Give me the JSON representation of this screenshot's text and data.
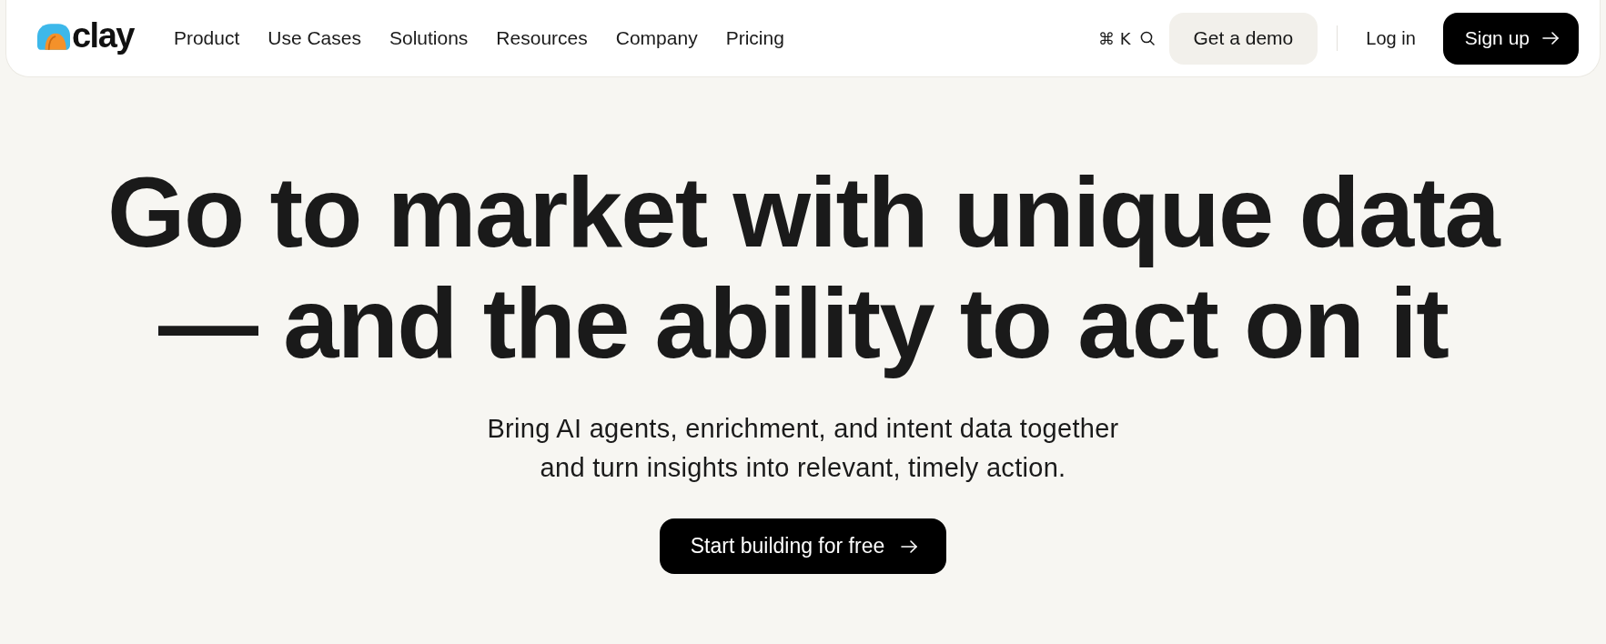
{
  "nav": {
    "logo": {
      "text": "clay"
    },
    "links": [
      {
        "label": "Product"
      },
      {
        "label": "Use Cases"
      },
      {
        "label": "Solutions"
      },
      {
        "label": "Resources"
      },
      {
        "label": "Company"
      },
      {
        "label": "Pricing"
      }
    ],
    "search": {
      "shortcut": "⌘ K"
    },
    "actions": [
      {
        "kind": "secondary",
        "label": "Get a demo"
      },
      {
        "kind": "link",
        "label": "Log in"
      },
      {
        "kind": "primary",
        "label": "Sign up"
      }
    ]
  },
  "hero": {
    "headline": "Go to market with unique data — and the ability to act on it",
    "subheadline": "Bring AI agents, enrichment, and intent data together and turn insights into relevant, timely action.",
    "cta": {
      "label": "Start building for free"
    }
  }
}
